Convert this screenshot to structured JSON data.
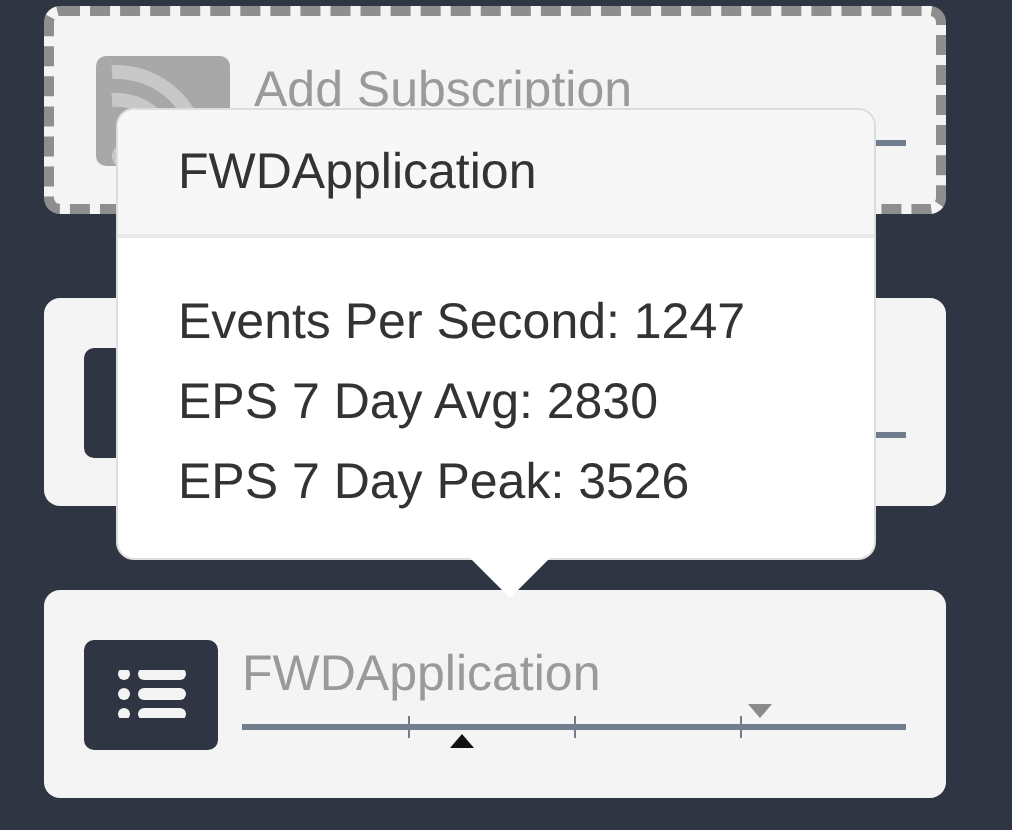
{
  "cards": [
    {
      "kind": "add",
      "title": "Add Subscription",
      "dashed": true
    },
    {
      "kind": "feed"
    },
    {
      "kind": "feed",
      "title": "FWDApplication",
      "markers": [
        {
          "kind": "current",
          "level": 0.33
        },
        {
          "kind": "peak",
          "level": 0.78
        }
      ]
    }
  ],
  "popover": {
    "title": "FWDApplication",
    "lines": [
      "Events Per Second: 1247",
      "EPS 7 Day Avg: 2830",
      "EPS 7 Day Peak: 3526"
    ]
  }
}
